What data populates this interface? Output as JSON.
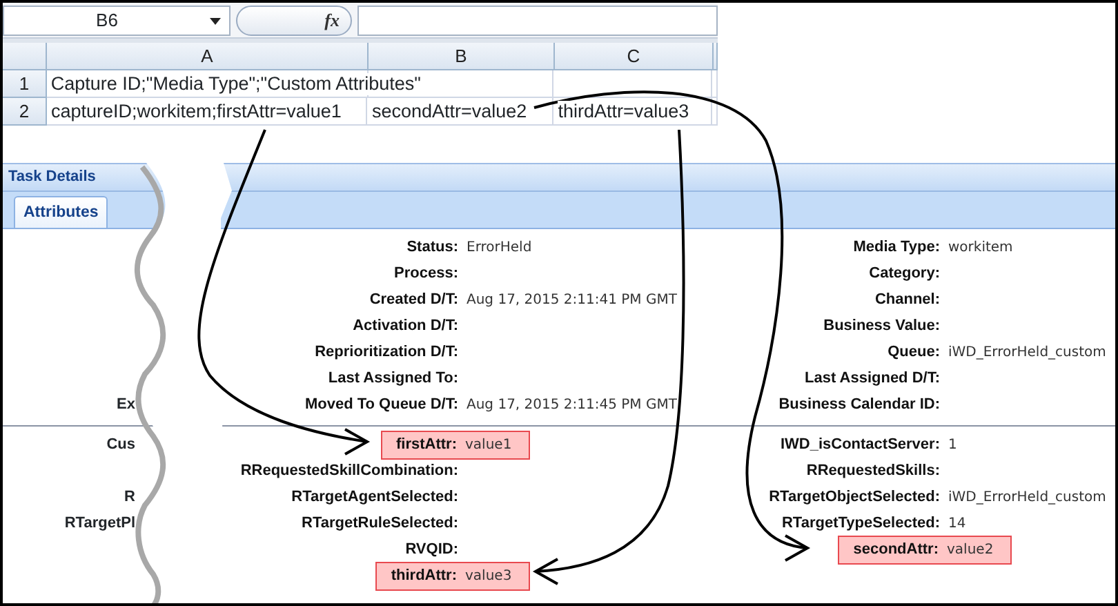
{
  "spreadsheet": {
    "name_box": "B6",
    "formula_label": "fx",
    "columns": [
      "A",
      "B",
      "C"
    ],
    "rows": [
      {
        "number": "1",
        "cells": [
          "Capture ID;\"Media Type\";\"Custom Attributes\""
        ]
      },
      {
        "number": "2",
        "cells": [
          "captureID;workitem;firstAttr=value1",
          "secondAttr=value2",
          "thirdAttr=value3"
        ]
      }
    ]
  },
  "task_details": {
    "title": "Task Details",
    "tabs": [
      {
        "label": "Attributes",
        "selected": true
      }
    ],
    "sections": [
      {
        "rows": [
          {
            "left": {
              "label": "Status:",
              "value": "ErrorHeld",
              "highlighted": false
            },
            "right": {
              "label": "Media Type:",
              "value": "workitem",
              "highlighted": false
            }
          },
          {
            "left": {
              "label": "Process:",
              "highlighted": false
            },
            "right": {
              "label": "Category:",
              "highlighted": false
            }
          },
          {
            "left": {
              "label": "Created D/T:",
              "value": "Aug 17, 2015 2:11:41 PM GMT",
              "highlighted": false
            },
            "right": {
              "label": "Channel:",
              "highlighted": false
            }
          },
          {
            "left": {
              "label": "Activation D/T:",
              "highlighted": false
            },
            "right": {
              "label": "Business Value:",
              "highlighted": false
            }
          },
          {
            "left": {
              "label": "Reprioritization D/T:",
              "highlighted": false
            },
            "right": {
              "label": "Queue:",
              "value": "iWD_ErrorHeld_custom",
              "highlighted": false
            }
          },
          {
            "left": {
              "label": "Last Assigned To:",
              "highlighted": false
            },
            "right": {
              "label": "Last Assigned D/T:",
              "highlighted": false
            }
          },
          {
            "stub": "Ex",
            "left": {
              "label": "Moved To Queue D/T:",
              "value": "Aug 17, 2015 2:11:45 PM GMT",
              "highlighted": false
            },
            "right": {
              "label": "Business Calendar ID:",
              "highlighted": false
            }
          }
        ]
      },
      {
        "rows": [
          {
            "stub": "Cus",
            "left": {
              "label": "firstAttr:",
              "value": "value1",
              "highlighted": true
            },
            "right": {
              "label": "IWD_isContactServer:",
              "value": "1",
              "highlighted": false
            }
          },
          {
            "left": {
              "label": "RRequestedSkillCombination:",
              "highlighted": false
            },
            "right": {
              "label": "RRequestedSkills:",
              "highlighted": false
            }
          },
          {
            "stub": "R",
            "left": {
              "label": "RTargetAgentSelected:",
              "highlighted": false
            },
            "right": {
              "label": "RTargetObjectSelected:",
              "value": "iWD_ErrorHeld_custom",
              "highlighted": false
            }
          },
          {
            "stub": "RTargetPl",
            "left": {
              "label": "RTargetRuleSelected:",
              "highlighted": false
            },
            "right": {
              "label": "RTargetTypeSelected:",
              "value": "14",
              "highlighted": false
            }
          },
          {
            "left": {
              "label": "RVQID:",
              "highlighted": false
            },
            "right": {
              "label": "secondAttr:",
              "value": "value2",
              "highlighted": true
            }
          },
          {
            "left": {
              "label": "thirdAttr:",
              "value": "value3",
              "highlighted": true
            }
          }
        ]
      }
    ]
  }
}
